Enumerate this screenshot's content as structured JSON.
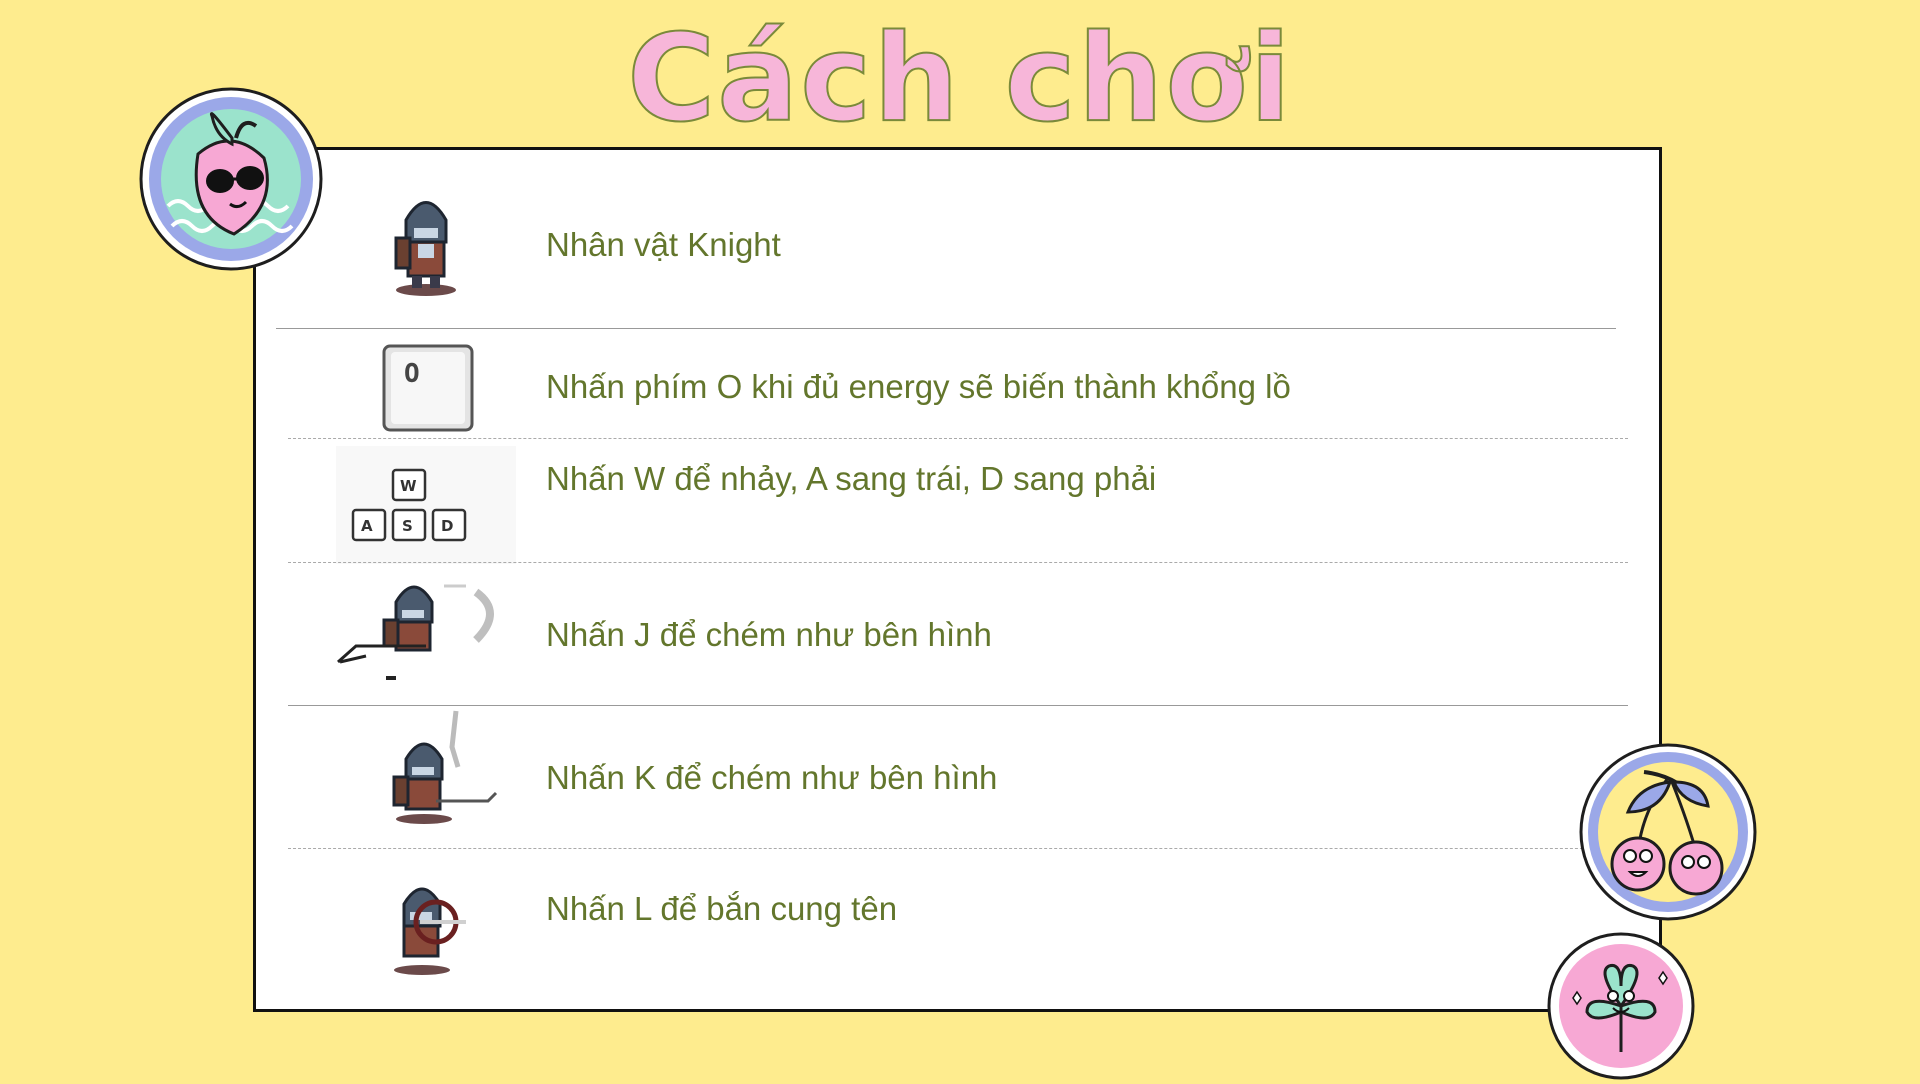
{
  "title": "Cách chơi",
  "instructions": [
    {
      "label": "Nhân vật Knight",
      "icon": "knight-character-icon"
    },
    {
      "label": "Nhấn phím O khi đủ energy sẽ  biến thành khổng lồ",
      "icon": "o-key-icon",
      "key": "O"
    },
    {
      "label": "Nhấn W để nhảy, A sang trái, D sang phải",
      "icon": "wasd-keys-icon",
      "keys": [
        "W",
        "A",
        "S",
        "D"
      ]
    },
    {
      "label": "Nhấn J để chém như bên hình",
      "icon": "knight-slash-j-icon"
    },
    {
      "label": "Nhấn K để chém như bên hình",
      "icon": "knight-slash-k-icon"
    },
    {
      "label": "Nhấn L để bắn cung tên",
      "icon": "knight-bow-icon"
    }
  ],
  "stickers": [
    "peach-sunglasses-sticker",
    "cherries-sticker",
    "clover-sticker"
  ],
  "colors": {
    "background": "#FEEC8E",
    "title": "#F7B6D9",
    "text": "#63762C",
    "sticker_ring": "#9BA8E8"
  }
}
